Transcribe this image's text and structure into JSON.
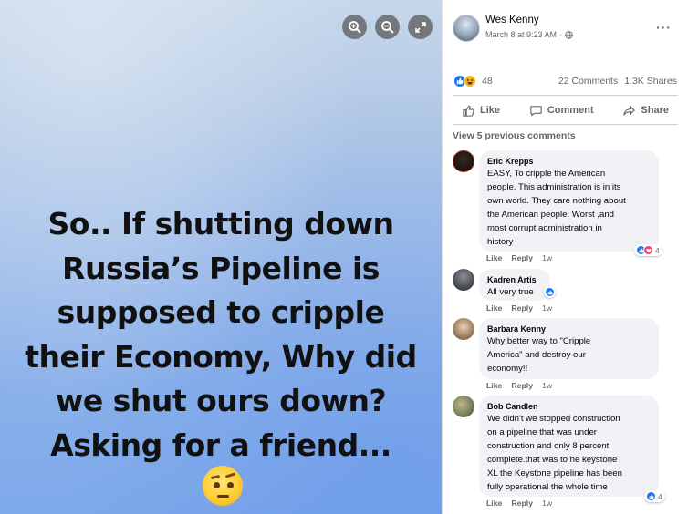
{
  "photo": {
    "text_lines": [
      "So.. If shutting down",
      "Russia’s Pipeline is",
      "supposed to cripple",
      "their Economy, Why did",
      "we shut ours down?",
      "Asking for a friend..."
    ],
    "emoji_icon": "raised-eyebrow-emoji-icon",
    "controls": [
      "zoom-in-icon",
      "zoom-out-icon",
      "fullscreen-icon"
    ]
  },
  "post": {
    "author": "Wes Kenny",
    "date": "March 8 at 9:23 AM",
    "separator": "·",
    "privacy_icon": "globe-icon",
    "more": "···",
    "reaction_count": "48",
    "comments_count": "22 Comments",
    "shares_count": "1.3K Shares",
    "actions": {
      "like": "Like",
      "comment": "Comment",
      "share": "Share"
    },
    "view_previous": "View 5 previous comments"
  },
  "comments": [
    {
      "name": "Eric Krepps",
      "text": [
        "EASY, To cripple the American",
        "people. This administration is in its",
        "own world. They care nothing about",
        "the American people. Worst ,and",
        "most corrupt administration in",
        "history"
      ],
      "like": "Like",
      "reply": "Reply",
      "time": "1w",
      "reactions": "4"
    },
    {
      "name": "Kadren Artis",
      "text": [
        "All very true"
      ],
      "like": "Like",
      "reply": "Reply",
      "time": "1w",
      "reactions": ""
    },
    {
      "name": "Barbara Kenny",
      "text": [
        "Why better way to \"Cripple",
        "America\" and destroy our",
        "economy!!"
      ],
      "like": "Like",
      "reply": "Reply",
      "time": "1w",
      "reactions": ""
    },
    {
      "name": "Bob Candlen",
      "text": [
        "We didn't we stopped construction",
        "on a pipeline that was under",
        "construction and only 8 percent",
        "complete.that was to he keystone",
        "XL the Keystone pipeline has been",
        "fully operational the whole time"
      ],
      "like": "Like",
      "reply": "Reply",
      "time": "1w",
      "reactions": "4"
    }
  ],
  "colors": {
    "facebook_blue": "#1877f2",
    "love_red": "#f33e58",
    "haha_yellow": "#f7b125",
    "secondary_text": "#65676b",
    "bubble": "#f0f2f5"
  }
}
